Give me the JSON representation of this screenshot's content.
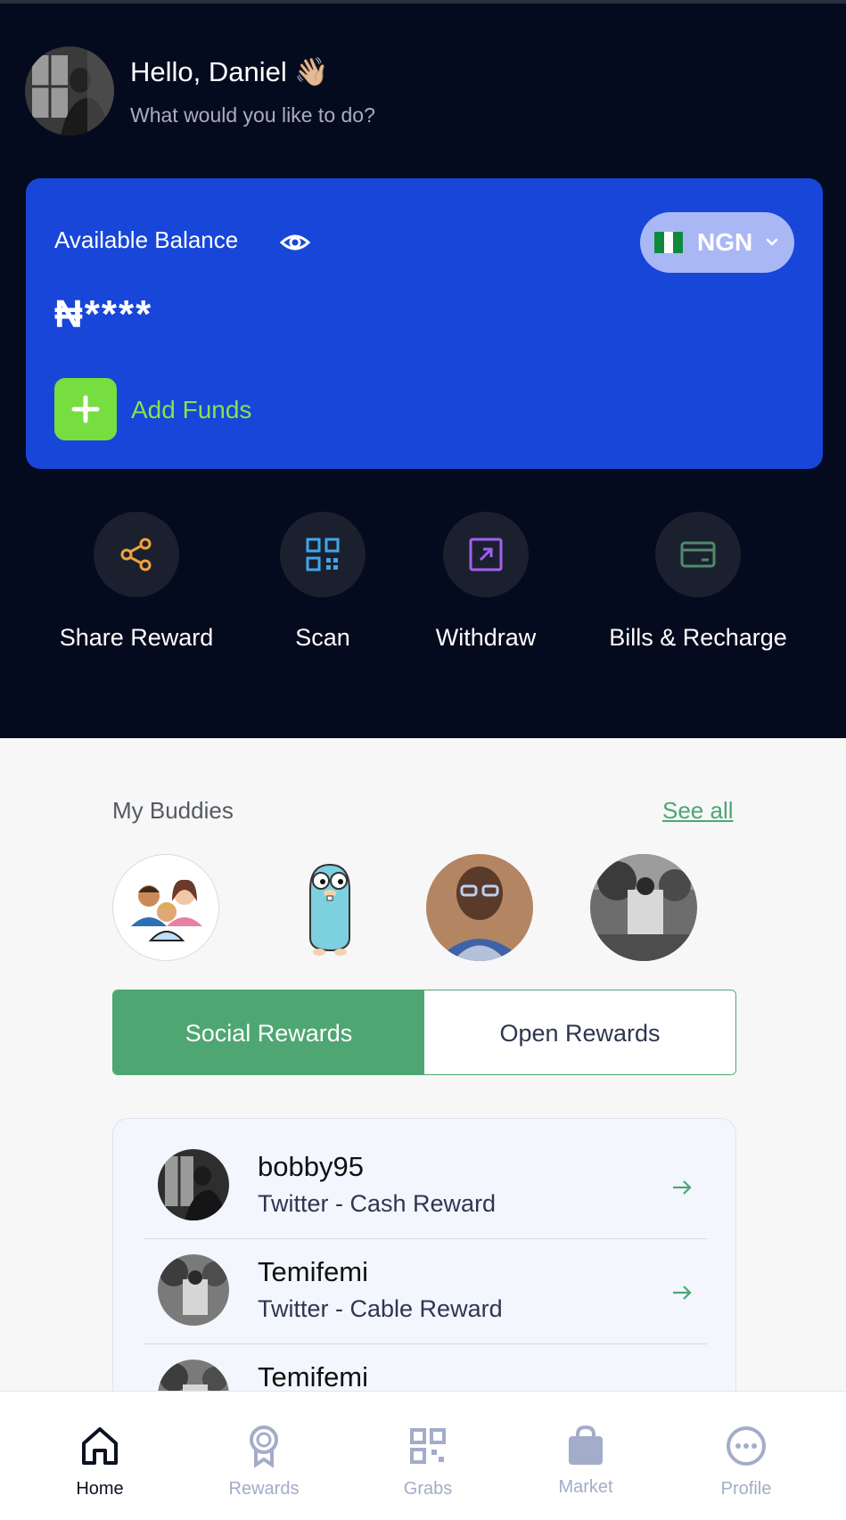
{
  "header": {
    "greeting": "Hello, Daniel 👋🏼",
    "subtitle": "What would you like to do?",
    "avatar_icon": "user-avatar-photo"
  },
  "balance_card": {
    "label": "Available Balance",
    "visibility_icon": "eye-icon",
    "amount": "₦****",
    "currency": "NGN",
    "currency_flag": "nigeria-flag-icon",
    "add_funds_label": "Add Funds",
    "accent": "#1746d8",
    "add_color": "#76de3e"
  },
  "actions": [
    {
      "label": "Share Reward",
      "icon": "share-icon",
      "color": "#f0a23c"
    },
    {
      "label": "Scan",
      "icon": "qr-code-icon",
      "color": "#3fa7e8"
    },
    {
      "label": "Withdraw",
      "icon": "withdraw-arrow-icon",
      "color": "#a35ff0"
    },
    {
      "label": "Bills & Recharge",
      "icon": "card-icon",
      "color": "#4f8a6c"
    }
  ],
  "buddies": {
    "title": "My Buddies",
    "see_all": "See all",
    "avatars": [
      "group-avatar",
      "gopher-avatar",
      "man-photo-avatar",
      "outdoor-photo-avatar"
    ]
  },
  "tabs": {
    "active": "Social Rewards",
    "inactive": "Open Rewards",
    "accent": "#4ea673"
  },
  "rewards": [
    {
      "name": "bobby95",
      "desc": "Twitter - Cash Reward"
    },
    {
      "name": "Temifemi",
      "desc": "Twitter - Cable Reward"
    },
    {
      "name": "Temifemi",
      "desc": ""
    }
  ],
  "nav": [
    {
      "label": "Home",
      "icon": "home-icon",
      "active": true
    },
    {
      "label": "Rewards",
      "icon": "rewards-medal-icon",
      "active": false
    },
    {
      "label": "Grabs",
      "icon": "grid-icon",
      "active": false
    },
    {
      "label": "Market",
      "icon": "shopping-bag-icon",
      "active": false
    },
    {
      "label": "Profile",
      "icon": "more-dots-icon",
      "active": false
    }
  ]
}
